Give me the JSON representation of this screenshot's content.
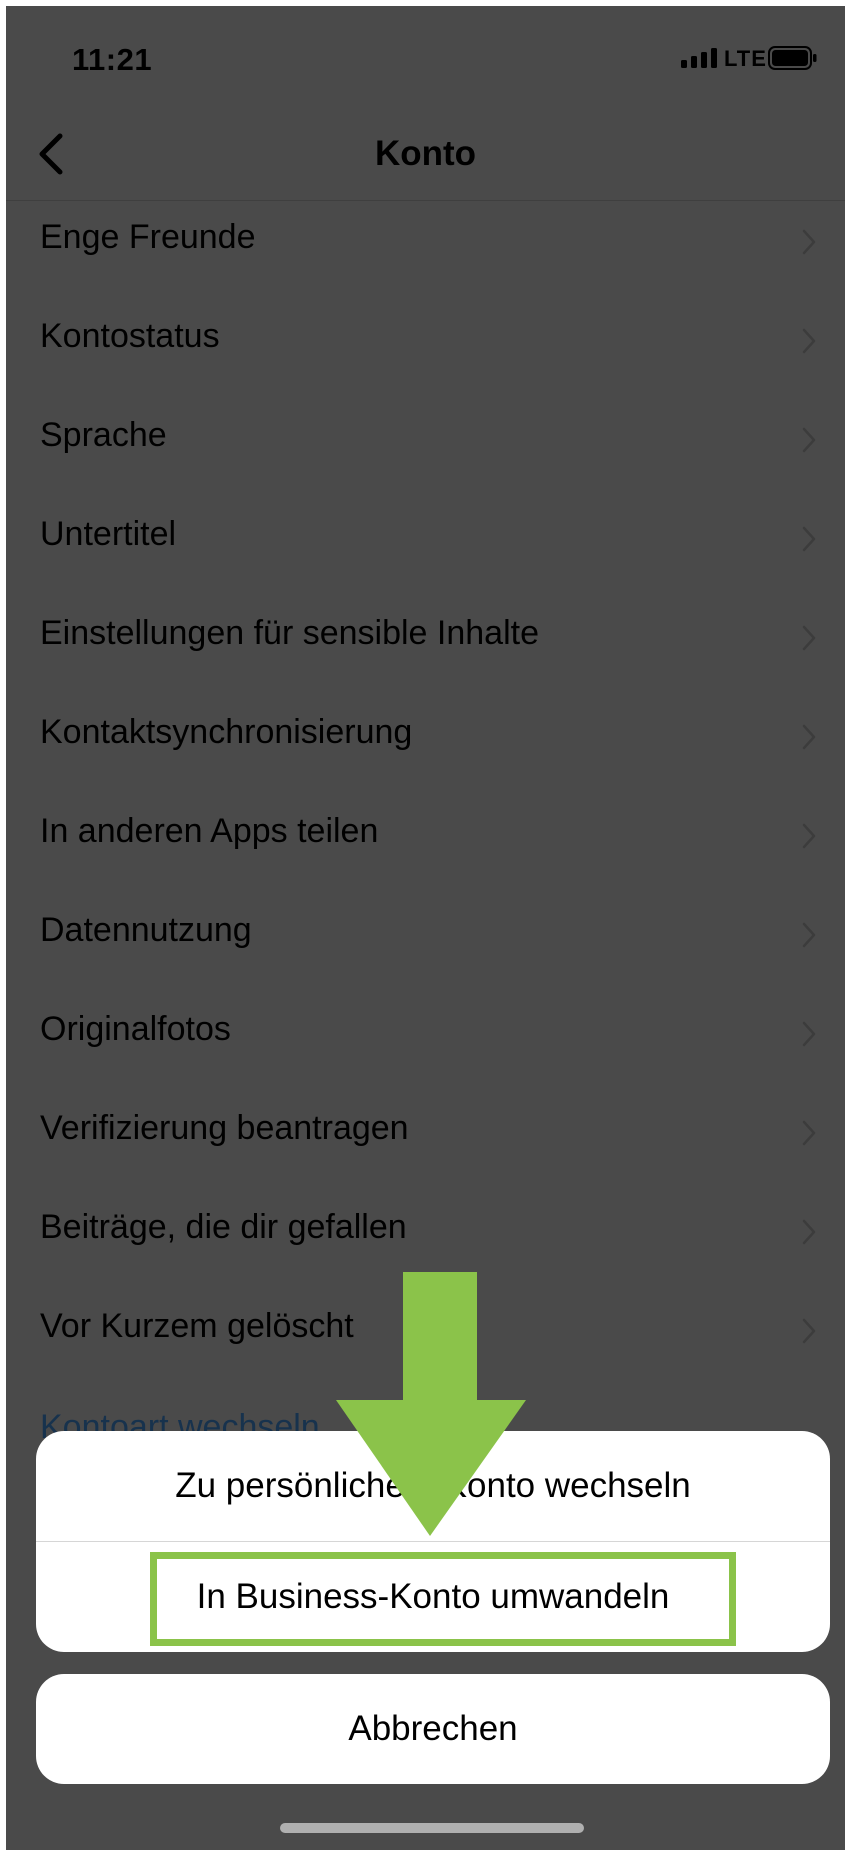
{
  "status_bar": {
    "time": "11:21",
    "network": "LTE"
  },
  "nav": {
    "title": "Konto",
    "back_icon": "chevron-left-icon"
  },
  "settings": {
    "items": [
      {
        "label": "Enge Freunde"
      },
      {
        "label": "Kontostatus"
      },
      {
        "label": "Sprache"
      },
      {
        "label": "Untertitel"
      },
      {
        "label": "Einstellungen für sensible Inhalte"
      },
      {
        "label": "Kontaktsynchronisierung"
      },
      {
        "label": "In anderen Apps teilen"
      },
      {
        "label": "Datennutzung"
      },
      {
        "label": "Originalfotos"
      },
      {
        "label": "Verifizierung beantragen"
      },
      {
        "label": "Beiträge, die dir gefallen"
      },
      {
        "label": "Vor Kurzem gelöscht"
      }
    ],
    "switch_account_type": "Kontoart wechseln"
  },
  "action_sheet": {
    "option_personal": "Zu persönlichem Konto wechseln",
    "option_business": "In Business-Konto umwandeln",
    "cancel": "Abbrechen"
  },
  "colors": {
    "overlay_bg": "#4a4a4a",
    "annotation_green": "#8bc34a",
    "link": "#17324d"
  }
}
